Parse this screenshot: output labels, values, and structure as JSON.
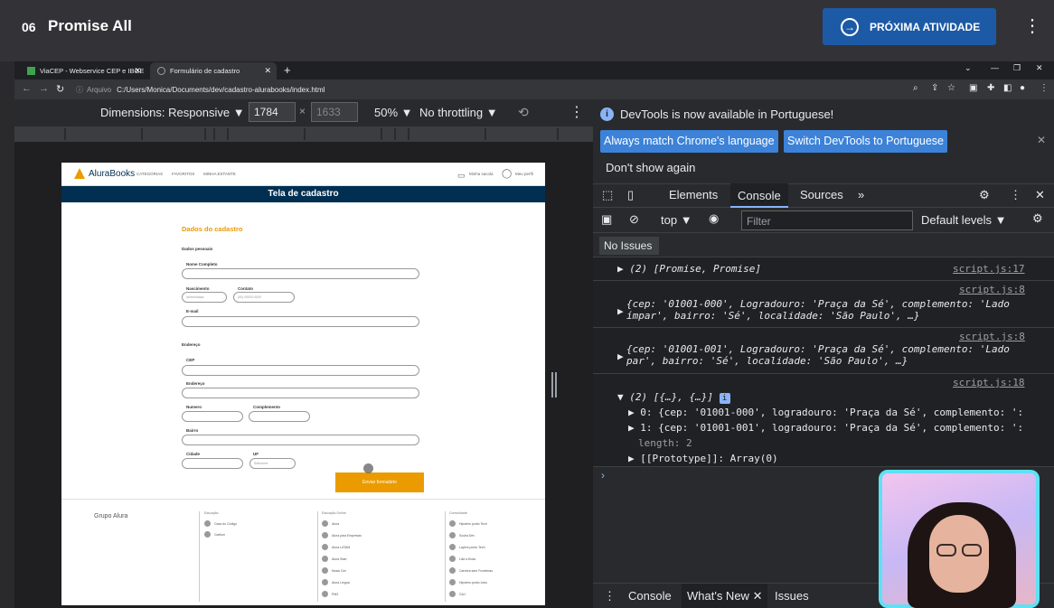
{
  "lesson": {
    "number": "06",
    "title": "Promise All",
    "next_label": "PRÓXIMA ATIVIDADE"
  },
  "browser": {
    "tabs": [
      {
        "label": "ViaCEP - Webservice CEP e IBGE"
      },
      {
        "label": "Formulário de cadastro"
      }
    ],
    "address_label": "Arquivo",
    "url": "C:/Users/Monica/Documents/dev/cadastro-alurabooks/index.html"
  },
  "device_toolbar": {
    "dimensions": "Dimensions: Responsive",
    "width": "1784",
    "height": "1633",
    "zoom": "50%",
    "throttle": "No throttling"
  },
  "page": {
    "brand": "AluraBooks",
    "nav": [
      "CATEGORIAS",
      "FAVORITOS",
      "MINHA ESTANTE"
    ],
    "nav_right": [
      "Minha sacola",
      "Meu perfil"
    ],
    "banner": "Tela de cadastro",
    "section_title": "Dados do cadastro",
    "personal_label": "Dados pessoais",
    "fields": {
      "nome": "Nome Completo",
      "nascimento": "Nascimento",
      "nascimento_ph": "dd/mm/aaaa",
      "contato": "Contato",
      "contato_ph": "(00) 00000-0000",
      "email": "E-mail",
      "endereco_section": "Endereço",
      "cep": "CEP",
      "endereco": "Endereço",
      "numero": "Numero",
      "complemento": "Complemento",
      "bairro": "Bairro",
      "cidade": "Cidade",
      "uf": "UF",
      "uf_value": "Selecione"
    },
    "submit": "Enviar formulário",
    "footer": {
      "brand": "Grupo Alura",
      "col1_head": "Educação",
      "col1": [
        "Casa do Código",
        "Caelum"
      ],
      "col2_head": "Educação Online",
      "col2": [
        "Alura",
        "Alura para Empresas",
        "Alura LATAM",
        "Alura Start",
        "Music Dot",
        "Alura Língua",
        "PM3"
      ],
      "col3_head": "Comunidade",
      "col3": [
        "Hipsters ponto Tech",
        "Scuba Dev",
        "Layers ponto Tech",
        "Like a Boss",
        "Carreira sem Fronteiras",
        "Hipsters ponto Jobs",
        "GUJ"
      ]
    }
  },
  "devtools": {
    "info": "DevTools is now available in Portuguese!",
    "btn_match": "Always match Chrome's language",
    "btn_switch": "Switch DevTools to Portuguese",
    "dont_show": "Don't show again",
    "tabs": [
      "Elements",
      "Console",
      "Sources"
    ],
    "active_tab": "Console",
    "context": "top",
    "filter_placeholder": "Filter",
    "levels": "Default levels",
    "no_issues": "No Issues",
    "drawer_tabs": [
      "Console",
      "What's New",
      "Issues"
    ]
  },
  "console": [
    {
      "text": "(2) [Promise, Promise]",
      "src": "script.js:17"
    },
    {
      "line1": "{cep: '01001-000', Logradouro: 'Praça da Sé', complemento: 'Lado",
      "line2": "ímpar', bairro: 'Sé', localidade: 'São Paulo', …}",
      "src": "script.js:8"
    },
    {
      "line1": "{cep: '01001-001', Logradouro: 'Praça da Sé', complemento: 'Lado",
      "line2": "par', bairro: 'Sé', localidade: 'São Paulo', …}",
      "src": "script.js:8"
    },
    {
      "text": "(2) [{…}, {…}]",
      "src": "script.js:18",
      "items": [
        "0: {cep: '01001-000', logradouro: 'Praça da Sé', complemento: ':",
        "1: {cep: '01001-001', logradouro: 'Praça da Sé', complemento: ':",
        "length: 2",
        "[[Prototype]]: Array(0)"
      ]
    }
  ],
  "colors": {
    "accent": "#1d5aa6",
    "brand_orange": "#eb9b00",
    "brand_navy": "#002f52",
    "webcam_border": "#5ee1f4"
  }
}
